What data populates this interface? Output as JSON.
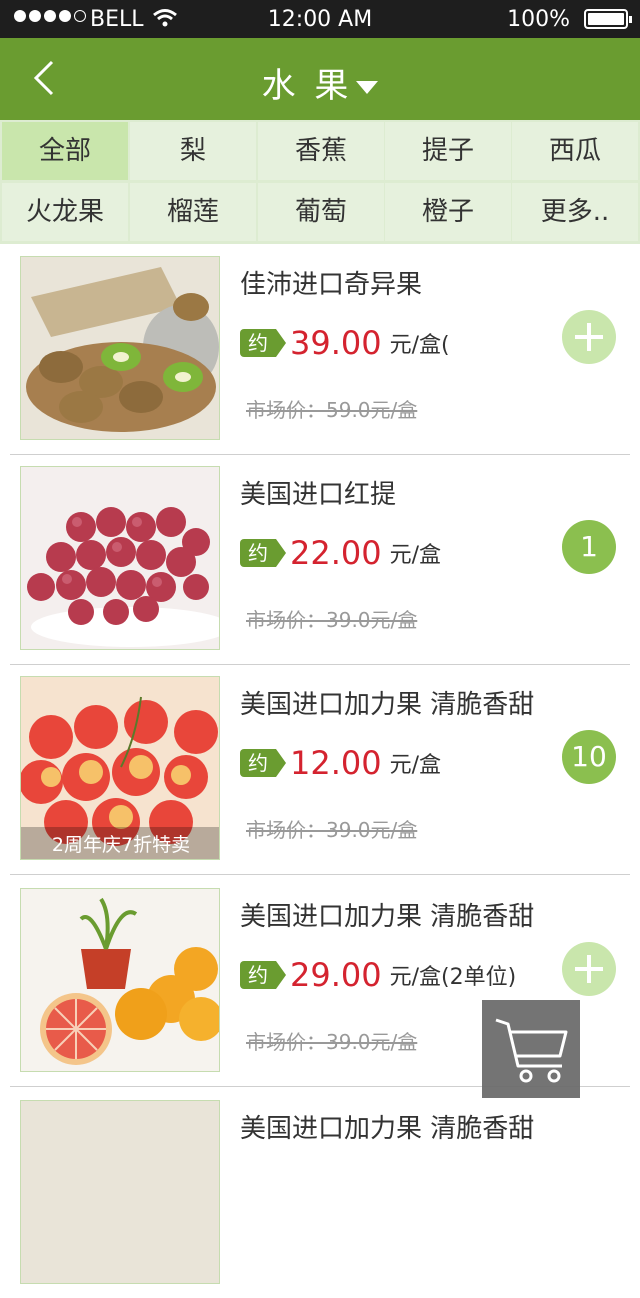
{
  "status_bar": {
    "carrier": "BELL",
    "time": "12:00 AM",
    "battery": "100%"
  },
  "nav": {
    "title": "水 果"
  },
  "categories": [
    "全部",
    "梨",
    "香蕉",
    "提子",
    "西瓜",
    "火龙果",
    "榴莲",
    "葡萄",
    "橙子",
    "更多.."
  ],
  "products": [
    {
      "name": "佳沛进口奇异果",
      "yue": "约",
      "price": "39.00",
      "unit": "元/盒(",
      "market": "市场价：59.0元/盒",
      "badge": "+",
      "image_label": ""
    },
    {
      "name": "美国进口红提",
      "yue": "约",
      "price": "22.00",
      "unit": "元/盒",
      "market": "市场价：39.0元/盒",
      "badge": "1",
      "image_label": ""
    },
    {
      "name": "美国进口加力果 清脆香甜",
      "yue": "约",
      "price": "12.00",
      "unit": "元/盒",
      "market": "市场价：39.0元/盒",
      "badge": "10",
      "image_label": "2周年庆7折特卖"
    },
    {
      "name": "美国进口加力果 清脆香甜",
      "yue": "约",
      "price": "29.00",
      "unit": "元/盒(2单位)",
      "market": "市场价：39.0元/盒",
      "badge": "+",
      "image_label": ""
    },
    {
      "name": "美国进口加力果 清脆香甜",
      "yue": "",
      "price": "",
      "unit": "",
      "market": "",
      "badge": "",
      "image_label": ""
    }
  ],
  "colors": {
    "brand_green": "#6a9c30",
    "price_red": "#d4232f",
    "category_bg": "#e6f1dd",
    "category_active": "#c9e6ac"
  },
  "icons": {
    "back": "chevron-left-icon",
    "dropdown": "caret-down-icon",
    "add": "plus-icon",
    "cart": "shopping-cart-icon"
  }
}
